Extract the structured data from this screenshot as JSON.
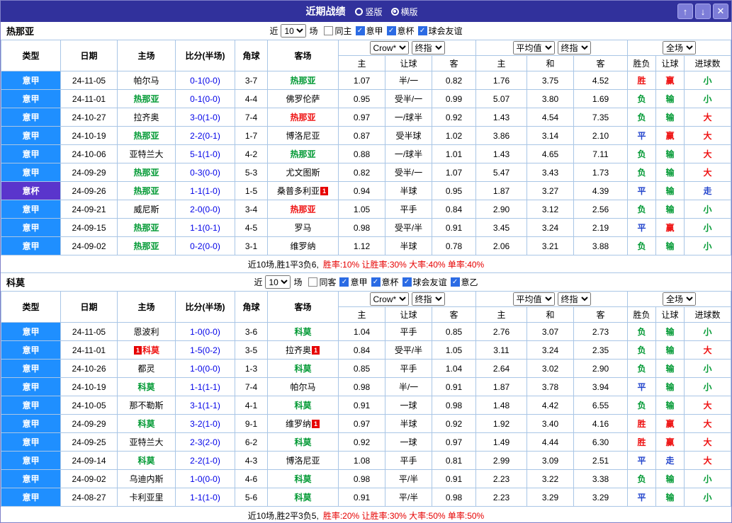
{
  "header": {
    "title": "近期战绩",
    "layout_options": [
      {
        "label": "竖版",
        "selected": false
      },
      {
        "label": "横版",
        "selected": true
      }
    ],
    "up_icon": "↑",
    "down_icon": "↓",
    "close_icon": "✕"
  },
  "table_header": {
    "static_cols": [
      "类型",
      "日期",
      "主场",
      "比分(半场)",
      "角球",
      "客场"
    ],
    "groups": [
      {
        "selects": [
          "Crow*",
          "终指"
        ],
        "subs": [
          "主",
          "让球",
          "客"
        ]
      },
      {
        "selects": [
          "平均值",
          "终指"
        ],
        "subs": [
          "主",
          "和",
          "客"
        ]
      },
      {
        "selects": [
          "全场"
        ],
        "subs": [
          "胜负",
          "让球",
          "进球数"
        ]
      }
    ]
  },
  "sections": [
    {
      "team": "热那亚",
      "filter": {
        "prefix": "近",
        "count": "10",
        "suffix": "场",
        "checkboxes": [
          {
            "label": "同主",
            "checked": false
          },
          {
            "label": "意甲",
            "checked": true
          },
          {
            "label": "意杯",
            "checked": true
          },
          {
            "label": "球会友谊",
            "checked": true
          }
        ]
      },
      "rows": [
        {
          "type": "意甲",
          "type_highlight": false,
          "date": "24-11-05",
          "home": {
            "text": "帕尔马",
            "color": "black"
          },
          "score": "0-1(0-0)",
          "corner": "3-7",
          "away": {
            "text": "热那亚",
            "color": "green"
          },
          "odds": [
            "1.07",
            "半/一",
            "0.82"
          ],
          "europe": [
            "1.76",
            "3.75",
            "4.52"
          ],
          "result": [
            {
              "t": "胜",
              "c": "red"
            },
            {
              "t": "赢",
              "c": "red"
            },
            {
              "t": "小",
              "c": "green"
            }
          ]
        },
        {
          "type": "意甲",
          "type_highlight": false,
          "date": "24-11-01",
          "home": {
            "text": "热那亚",
            "color": "green"
          },
          "score": "0-1(0-0)",
          "corner": "4-4",
          "away": {
            "text": "佛罗伦萨",
            "color": "black"
          },
          "odds": [
            "0.95",
            "受半/一",
            "0.99"
          ],
          "europe": [
            "5.07",
            "3.80",
            "1.69"
          ],
          "result": [
            {
              "t": "负",
              "c": "green"
            },
            {
              "t": "输",
              "c": "green"
            },
            {
              "t": "小",
              "c": "green"
            }
          ]
        },
        {
          "type": "意甲",
          "type_highlight": false,
          "date": "24-10-27",
          "home": {
            "text": "拉齐奥",
            "color": "black"
          },
          "score": "3-0(1-0)",
          "corner": "7-4",
          "away": {
            "text": "热那亚",
            "color": "red"
          },
          "odds": [
            "0.97",
            "一/球半",
            "0.92"
          ],
          "europe": [
            "1.43",
            "4.54",
            "7.35"
          ],
          "result": [
            {
              "t": "负",
              "c": "green"
            },
            {
              "t": "输",
              "c": "green"
            },
            {
              "t": "大",
              "c": "red"
            }
          ]
        },
        {
          "type": "意甲",
          "type_highlight": false,
          "date": "24-10-19",
          "home": {
            "text": "热那亚",
            "color": "green"
          },
          "score": "2-2(0-1)",
          "corner": "1-7",
          "away": {
            "text": "博洛尼亚",
            "color": "black"
          },
          "odds": [
            "0.87",
            "受半球",
            "1.02"
          ],
          "europe": [
            "3.86",
            "3.14",
            "2.10"
          ],
          "result": [
            {
              "t": "平",
              "c": "blue"
            },
            {
              "t": "赢",
              "c": "red"
            },
            {
              "t": "大",
              "c": "red"
            }
          ]
        },
        {
          "type": "意甲",
          "type_highlight": false,
          "date": "24-10-06",
          "home": {
            "text": "亚特兰大",
            "color": "black"
          },
          "score": "5-1(1-0)",
          "corner": "4-2",
          "away": {
            "text": "热那亚",
            "color": "green"
          },
          "odds": [
            "0.88",
            "一/球半",
            "1.01"
          ],
          "europe": [
            "1.43",
            "4.65",
            "7.11"
          ],
          "result": [
            {
              "t": "负",
              "c": "green"
            },
            {
              "t": "输",
              "c": "green"
            },
            {
              "t": "大",
              "c": "red"
            }
          ]
        },
        {
          "type": "意甲",
          "type_highlight": false,
          "date": "24-09-29",
          "home": {
            "text": "热那亚",
            "color": "green"
          },
          "score": "0-3(0-0)",
          "corner": "5-3",
          "away": {
            "text": "尤文图斯",
            "color": "black"
          },
          "odds": [
            "0.82",
            "受半/一",
            "1.07"
          ],
          "europe": [
            "5.47",
            "3.43",
            "1.73"
          ],
          "result": [
            {
              "t": "负",
              "c": "green"
            },
            {
              "t": "输",
              "c": "green"
            },
            {
              "t": "大",
              "c": "red"
            }
          ]
        },
        {
          "type": "意杯",
          "type_highlight": true,
          "date": "24-09-26",
          "home": {
            "text": "热那亚",
            "color": "green"
          },
          "score": "1-1(1-0)",
          "corner": "1-5",
          "away": {
            "text": "桑普多利亚",
            "color": "black",
            "badge": "1",
            "badge_pos": "after"
          },
          "odds": [
            "0.94",
            "半球",
            "0.95"
          ],
          "europe": [
            "1.87",
            "3.27",
            "4.39"
          ],
          "result": [
            {
              "t": "平",
              "c": "blue"
            },
            {
              "t": "输",
              "c": "green"
            },
            {
              "t": "走",
              "c": "blue"
            }
          ]
        },
        {
          "type": "意甲",
          "type_highlight": false,
          "date": "24-09-21",
          "home": {
            "text": "威尼斯",
            "color": "black"
          },
          "score": "2-0(0-0)",
          "corner": "3-4",
          "away": {
            "text": "热那亚",
            "color": "red"
          },
          "odds": [
            "1.05",
            "平手",
            "0.84"
          ],
          "europe": [
            "2.90",
            "3.12",
            "2.56"
          ],
          "result": [
            {
              "t": "负",
              "c": "green"
            },
            {
              "t": "输",
              "c": "green"
            },
            {
              "t": "小",
              "c": "green"
            }
          ]
        },
        {
          "type": "意甲",
          "type_highlight": false,
          "date": "24-09-15",
          "home": {
            "text": "热那亚",
            "color": "green"
          },
          "score": "1-1(0-1)",
          "corner": "4-5",
          "away": {
            "text": "罗马",
            "color": "black"
          },
          "odds": [
            "0.98",
            "受平/半",
            "0.91"
          ],
          "europe": [
            "3.45",
            "3.24",
            "2.19"
          ],
          "result": [
            {
              "t": "平",
              "c": "blue"
            },
            {
              "t": "赢",
              "c": "red"
            },
            {
              "t": "小",
              "c": "green"
            }
          ]
        },
        {
          "type": "意甲",
          "type_highlight": false,
          "date": "24-09-02",
          "home": {
            "text": "热那亚",
            "color": "green"
          },
          "score": "0-2(0-0)",
          "corner": "3-1",
          "away": {
            "text": "维罗纳",
            "color": "black"
          },
          "odds": [
            "1.12",
            "半球",
            "0.78"
          ],
          "europe": [
            "2.06",
            "3.21",
            "3.88"
          ],
          "result": [
            {
              "t": "负",
              "c": "green"
            },
            {
              "t": "输",
              "c": "green"
            },
            {
              "t": "小",
              "c": "green"
            }
          ]
        }
      ],
      "summary": {
        "record": "近10场,胜1平3负6,",
        "rates": "胜率:10% 让胜率:30% 大率:40% 单率:40%"
      }
    },
    {
      "team": "科莫",
      "filter": {
        "prefix": "近",
        "count": "10",
        "suffix": "场",
        "checkboxes": [
          {
            "label": "同客",
            "checked": false
          },
          {
            "label": "意甲",
            "checked": true
          },
          {
            "label": "意杯",
            "checked": true
          },
          {
            "label": "球会友谊",
            "checked": true
          },
          {
            "label": "意乙",
            "checked": true
          }
        ]
      },
      "rows": [
        {
          "type": "意甲",
          "type_highlight": false,
          "date": "24-11-05",
          "home": {
            "text": "恩波利",
            "color": "black"
          },
          "score": "1-0(0-0)",
          "corner": "3-6",
          "away": {
            "text": "科莫",
            "color": "green"
          },
          "odds": [
            "1.04",
            "平手",
            "0.85"
          ],
          "europe": [
            "2.76",
            "3.07",
            "2.73"
          ],
          "result": [
            {
              "t": "负",
              "c": "green"
            },
            {
              "t": "输",
              "c": "green"
            },
            {
              "t": "小",
              "c": "green"
            }
          ]
        },
        {
          "type": "意甲",
          "type_highlight": false,
          "date": "24-11-01",
          "home": {
            "text": "科莫",
            "color": "red",
            "badge": "1",
            "badge_pos": "before"
          },
          "score": "1-5(0-2)",
          "corner": "3-5",
          "away": {
            "text": "拉齐奥",
            "color": "black",
            "badge": "1",
            "badge_pos": "after"
          },
          "odds": [
            "0.84",
            "受平/半",
            "1.05"
          ],
          "europe": [
            "3.11",
            "3.24",
            "2.35"
          ],
          "result": [
            {
              "t": "负",
              "c": "green"
            },
            {
              "t": "输",
              "c": "green"
            },
            {
              "t": "大",
              "c": "red"
            }
          ]
        },
        {
          "type": "意甲",
          "type_highlight": false,
          "date": "24-10-26",
          "home": {
            "text": "都灵",
            "color": "black"
          },
          "score": "1-0(0-0)",
          "corner": "1-3",
          "away": {
            "text": "科莫",
            "color": "green"
          },
          "odds": [
            "0.85",
            "平手",
            "1.04"
          ],
          "europe": [
            "2.64",
            "3.02",
            "2.90"
          ],
          "result": [
            {
              "t": "负",
              "c": "green"
            },
            {
              "t": "输",
              "c": "green"
            },
            {
              "t": "小",
              "c": "green"
            }
          ]
        },
        {
          "type": "意甲",
          "type_highlight": false,
          "date": "24-10-19",
          "home": {
            "text": "科莫",
            "color": "green"
          },
          "score": "1-1(1-1)",
          "corner": "7-4",
          "away": {
            "text": "帕尔马",
            "color": "black"
          },
          "odds": [
            "0.98",
            "半/一",
            "0.91"
          ],
          "europe": [
            "1.87",
            "3.78",
            "3.94"
          ],
          "result": [
            {
              "t": "平",
              "c": "blue"
            },
            {
              "t": "输",
              "c": "green"
            },
            {
              "t": "小",
              "c": "green"
            }
          ]
        },
        {
          "type": "意甲",
          "type_highlight": false,
          "date": "24-10-05",
          "home": {
            "text": "那不勒斯",
            "color": "black"
          },
          "score": "3-1(1-1)",
          "corner": "4-1",
          "away": {
            "text": "科莫",
            "color": "green"
          },
          "odds": [
            "0.91",
            "一球",
            "0.98"
          ],
          "europe": [
            "1.48",
            "4.42",
            "6.55"
          ],
          "result": [
            {
              "t": "负",
              "c": "green"
            },
            {
              "t": "输",
              "c": "green"
            },
            {
              "t": "大",
              "c": "red"
            }
          ]
        },
        {
          "type": "意甲",
          "type_highlight": false,
          "date": "24-09-29",
          "home": {
            "text": "科莫",
            "color": "green"
          },
          "score": "3-2(1-0)",
          "corner": "9-1",
          "away": {
            "text": "维罗纳",
            "color": "black",
            "badge": "1",
            "badge_pos": "after"
          },
          "odds": [
            "0.97",
            "半球",
            "0.92"
          ],
          "europe": [
            "1.92",
            "3.40",
            "4.16"
          ],
          "result": [
            {
              "t": "胜",
              "c": "red"
            },
            {
              "t": "赢",
              "c": "red"
            },
            {
              "t": "大",
              "c": "red"
            }
          ]
        },
        {
          "type": "意甲",
          "type_highlight": false,
          "date": "24-09-25",
          "home": {
            "text": "亚特兰大",
            "color": "black"
          },
          "score": "2-3(2-0)",
          "corner": "6-2",
          "away": {
            "text": "科莫",
            "color": "green"
          },
          "odds": [
            "0.92",
            "一球",
            "0.97"
          ],
          "europe": [
            "1.49",
            "4.44",
            "6.30"
          ],
          "result": [
            {
              "t": "胜",
              "c": "red"
            },
            {
              "t": "赢",
              "c": "red"
            },
            {
              "t": "大",
              "c": "red"
            }
          ]
        },
        {
          "type": "意甲",
          "type_highlight": false,
          "date": "24-09-14",
          "home": {
            "text": "科莫",
            "color": "green"
          },
          "score": "2-2(1-0)",
          "corner": "4-3",
          "away": {
            "text": "博洛尼亚",
            "color": "black"
          },
          "odds": [
            "1.08",
            "平手",
            "0.81"
          ],
          "europe": [
            "2.99",
            "3.09",
            "2.51"
          ],
          "result": [
            {
              "t": "平",
              "c": "blue"
            },
            {
              "t": "走",
              "c": "blue"
            },
            {
              "t": "大",
              "c": "red"
            }
          ]
        },
        {
          "type": "意甲",
          "type_highlight": false,
          "date": "24-09-02",
          "home": {
            "text": "乌迪内斯",
            "color": "black"
          },
          "score": "1-0(0-0)",
          "corner": "4-6",
          "away": {
            "text": "科莫",
            "color": "green"
          },
          "odds": [
            "0.98",
            "平/半",
            "0.91"
          ],
          "europe": [
            "2.23",
            "3.22",
            "3.38"
          ],
          "result": [
            {
              "t": "负",
              "c": "green"
            },
            {
              "t": "输",
              "c": "green"
            },
            {
              "t": "小",
              "c": "green"
            }
          ]
        },
        {
          "type": "意甲",
          "type_highlight": false,
          "date": "24-08-27",
          "home": {
            "text": "卡利亚里",
            "color": "black"
          },
          "score": "1-1(1-0)",
          "corner": "5-6",
          "away": {
            "text": "科莫",
            "color": "green"
          },
          "odds": [
            "0.91",
            "平/半",
            "0.98"
          ],
          "europe": [
            "2.23",
            "3.29",
            "3.29"
          ],
          "result": [
            {
              "t": "平",
              "c": "blue"
            },
            {
              "t": "输",
              "c": "green"
            },
            {
              "t": "小",
              "c": "green"
            }
          ]
        }
      ],
      "summary": {
        "record": "近10场,胜2平3负5,",
        "rates": "胜率:20% 让胜率:30% 大率:50% 单率:50%"
      }
    }
  ]
}
